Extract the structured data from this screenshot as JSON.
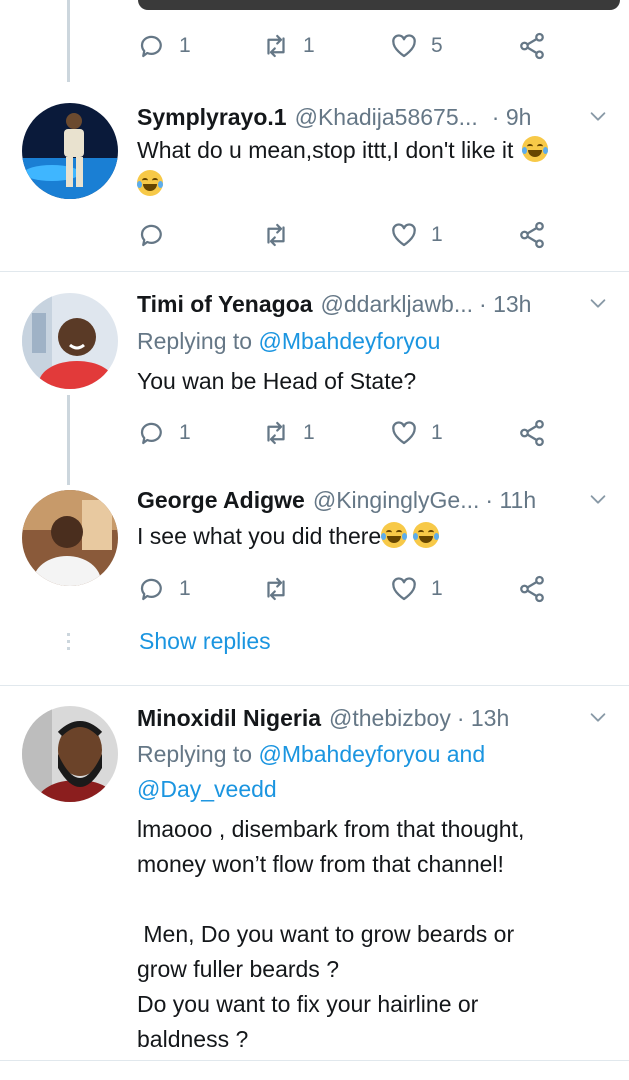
{
  "colors": {
    "link": "#1b95e0",
    "muted": "#657786",
    "text": "#14171a"
  },
  "icons": {
    "reply": "reply-icon",
    "retweet": "retweet-icon",
    "like": "heart-icon",
    "share": "share-icon",
    "chevron": "chevron-down-icon"
  },
  "top_actions": {
    "replies": "1",
    "retweets": "1",
    "likes": "5"
  },
  "tweets": [
    {
      "name": "Symplyrayo.1",
      "handle": "@Khadija58675...",
      "time": "· 9h",
      "text_line1": "What do u mean,stop ittt,I don't like it",
      "replies": "",
      "retweets": "",
      "likes": "1"
    },
    {
      "name": "Timi of Yenagoa",
      "handle": "@ddarkljawb...",
      "time": "· 13h",
      "replying_prefix": "Replying to",
      "replying_to": "@Mbahdeyforyou",
      "text_line1": "You wan be Head of State?",
      "replies": "1",
      "retweets": "1",
      "likes": "1"
    },
    {
      "name": "George Adigwe",
      "handle": "@KinginglyGe...",
      "time": "· 11h",
      "text_line1": "I see what you did there",
      "replies": "1",
      "retweets": "",
      "likes": "1",
      "show_replies": "Show replies"
    },
    {
      "name": "Minoxidil Nigeria",
      "handle": "@thebizboy",
      "time": "· 13h",
      "replying_prefix": "Replying to",
      "replying_to": "@Mbahdeyforyou",
      "replying_and": "and",
      "replying_to2": "@Day_veedd",
      "text_lines": [
        "lmaooo , disembark from that thought,",
        "money won’t flow from that channel!",
        "",
        " Men, Do you want to grow beards or",
        "grow fuller beards ?",
        "Do you want to fix your hairline or",
        "baldness ?"
      ]
    }
  ]
}
